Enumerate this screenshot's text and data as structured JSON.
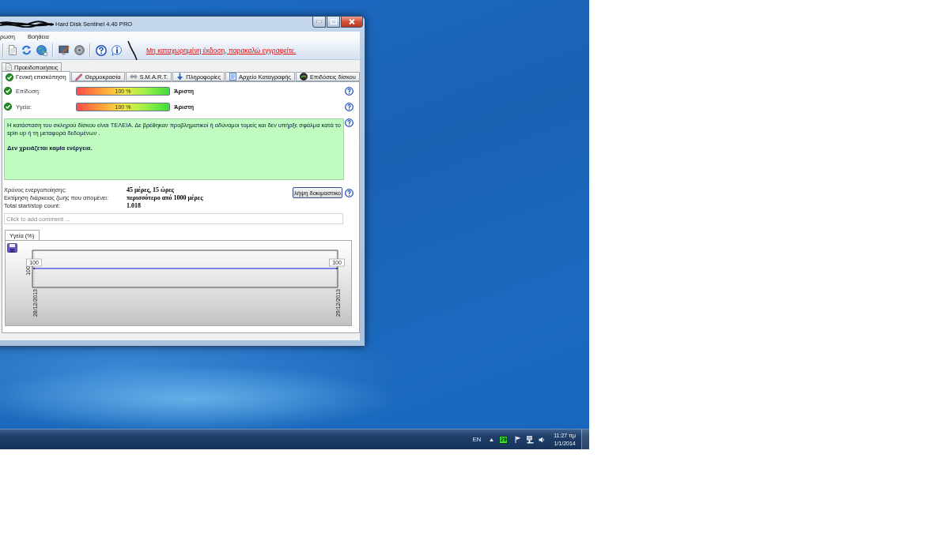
{
  "window": {
    "title": "Hard Disk Sentinel 4.40 PRO"
  },
  "menu_bar": [
    {
      "label": "ρωση"
    },
    {
      "label": "Βοήθεια"
    }
  ],
  "toolbar": {
    "notice": "Μη καταχωρημένη έκδοση, παρακαλώ εγγραφείτε."
  },
  "tabs_upper": [
    {
      "label": "Προειδοποιήσεις",
      "selected": false
    }
  ],
  "tabs": [
    {
      "label": "Γενική επισκόπηση",
      "selected": true
    },
    {
      "label": "Θερμοκρασία",
      "selected": false
    },
    {
      "label": "S.M.A.R.T.",
      "selected": false
    },
    {
      "label": "Πληροφορίες",
      "selected": false
    },
    {
      "label": "Αρχείο Καταγραφής",
      "selected": false
    },
    {
      "label": "Επιδόσεις δίσκου",
      "selected": false
    }
  ],
  "status": [
    {
      "label": "Επίδοση:",
      "ok": true,
      "level": 1,
      "reading": "100 %",
      "rating": "Άριστη"
    },
    {
      "label": "Υγεία:",
      "ok": true,
      "level": 1,
      "reading": "100 %",
      "rating": "Άριστη"
    }
  ],
  "summary": {
    "message": "Η κατάσταση του σκληρού δίσκου είναι ΤΕΛΕΙΑ. Δε βρέθηκαν προβληματικοί ή αδύναμοι τομείς και δεν υπήρξε σφάλμα κατά το spin up ή τη μεταφορά δεδομένων .",
    "advice": "Δεν χρειάζεται καμία ενέργεια."
  },
  "details": [
    {
      "label": "Χρόνος ενεργοποίησης:",
      "value": "45 μέρες, 15 ώρες"
    },
    {
      "label": "Εκτίμηση διάρκειας ζωής που απομένει:",
      "value": "περισσότερο από 1000 μέρες"
    },
    {
      "label": "Total start/stop count:",
      "value": "1.018"
    }
  ],
  "report_button": {
    "label": "λήψη δοκιμαστικο"
  },
  "comment": {
    "placeholder": "Click to add comment ..."
  },
  "chart_tabs": [
    {
      "label": "Υγεία (%)",
      "selected": true
    }
  ],
  "health_chart": {
    "y_label": "100",
    "point_labels": [
      "100",
      "100"
    ],
    "date_labels": [
      "28/12/2013",
      "29/12/2013"
    ]
  },
  "taskbar": {
    "language": "EN",
    "tray_badge": "29",
    "time": "11:27 πμ",
    "date": "1/1/2014"
  }
}
